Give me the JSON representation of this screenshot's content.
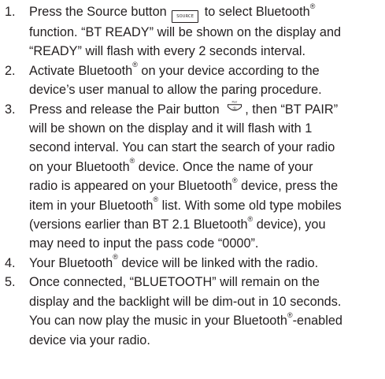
{
  "steps": [
    {
      "num": "1.",
      "lines": [
        [
          "Press the Source button ",
          "{source}",
          " to select Bluetooth",
          "{reg}"
        ],
        [
          "function. “BT READY” will be shown on the display and"
        ],
        [
          "“READY” will flash with every 2 seconds interval."
        ]
      ]
    },
    {
      "num": "2.",
      "lines": [
        [
          "Activate Bluetooth",
          "{reg}",
          " on your device according to the"
        ],
        [
          "device’s user manual to allow the paring procedure."
        ]
      ]
    },
    {
      "num": "3.",
      "lines": [
        [
          "Press and release the Pair button ",
          "{pair}",
          ", then “BT PAIR”"
        ],
        [
          "will be shown on the display and it will flash with 1"
        ],
        [
          "second interval. You can start the search of your radio"
        ],
        [
          "on your Bluetooth",
          "{reg}",
          " device. Once the name of your"
        ],
        [
          "radio is appeared on your Bluetooth",
          "{reg}",
          " device, press the"
        ],
        [
          "item in your Bluetooth",
          "{reg}",
          " list. With some old type mobiles"
        ],
        [
          "(versions earlier than BT 2.1 Bluetooth",
          "{reg}",
          " device), you"
        ],
        [
          "may need to input the pass code “0000”."
        ]
      ]
    },
    {
      "num": "4.",
      "lines": [
        [
          "Your Bluetooth",
          "{reg}",
          " device will be linked with the radio."
        ]
      ]
    },
    {
      "num": "5.",
      "lines": [
        [
          "Once connected, “BLUETOOTH” will remain on the"
        ],
        [
          "display and the backlight will be dim-out in 10 seconds."
        ],
        [
          "You can now play the music in your Bluetooth",
          "{reg}",
          "-enabled"
        ],
        [
          "device via your radio."
        ]
      ]
    }
  ],
  "source_button_label": "SOURCE",
  "pair_button_label": "Pair",
  "registered_mark": "®",
  "icons": {
    "source": "source-button-icon",
    "pair": "pair-button-icon"
  },
  "colors": {
    "text": "#231f20",
    "background": "#ffffff"
  }
}
